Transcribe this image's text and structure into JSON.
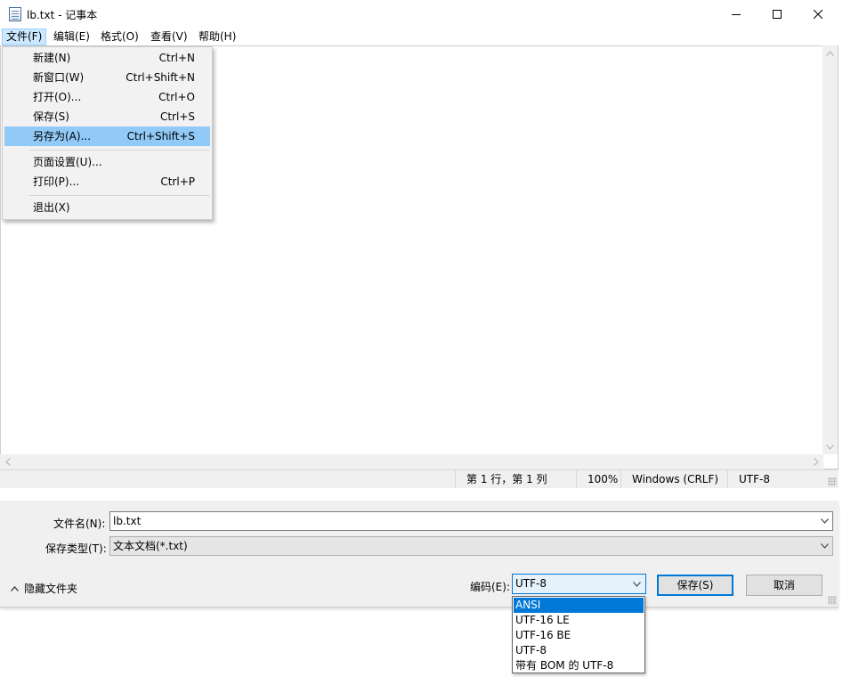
{
  "window": {
    "title": "lb.txt - 记事本"
  },
  "menubar": {
    "items": [
      "文件(F)",
      "编辑(E)",
      "格式(O)",
      "查看(V)",
      "帮助(H)"
    ]
  },
  "file_menu": {
    "items": [
      {
        "label": "新建(N)",
        "shortcut": "Ctrl+N"
      },
      {
        "label": "新窗口(W)",
        "shortcut": "Ctrl+Shift+N"
      },
      {
        "label": "打开(O)...",
        "shortcut": "Ctrl+O"
      },
      {
        "label": "保存(S)",
        "shortcut": "Ctrl+S"
      },
      {
        "label": "另存为(A)...",
        "shortcut": "Ctrl+Shift+S",
        "highlighted": true
      },
      {
        "label": "页面设置(U)...",
        "shortcut": ""
      },
      {
        "label": "打印(P)...",
        "shortcut": "Ctrl+P"
      },
      {
        "label": "退出(X)",
        "shortcut": ""
      }
    ]
  },
  "statusbar": {
    "position": "第 1 行，第 1 列",
    "zoom": "100%",
    "line_ending": "Windows (CRLF)",
    "encoding": "UTF-8"
  },
  "save_dialog": {
    "filename_label": "文件名(N):",
    "filename_value": "lb.txt",
    "filetype_label": "保存类型(T):",
    "filetype_value": "文本文档(*.txt)",
    "hide_folders_label": "隐藏文件夹",
    "encoding_label": "编码(E):",
    "encoding_value": "UTF-8",
    "save_button": "保存(S)",
    "cancel_button": "取消"
  },
  "encoding_options": {
    "items": [
      "ANSI",
      "UTF-16 LE",
      "UTF-16 BE",
      "UTF-8",
      "带有 BOM 的 UTF-8"
    ],
    "selected": "ANSI"
  },
  "colors": {
    "menu_highlight": "#91c9f7",
    "menu_active_bg": "#cce8ff",
    "selection_blue": "#0078d7",
    "dialog_bg": "#f0f0f0"
  }
}
